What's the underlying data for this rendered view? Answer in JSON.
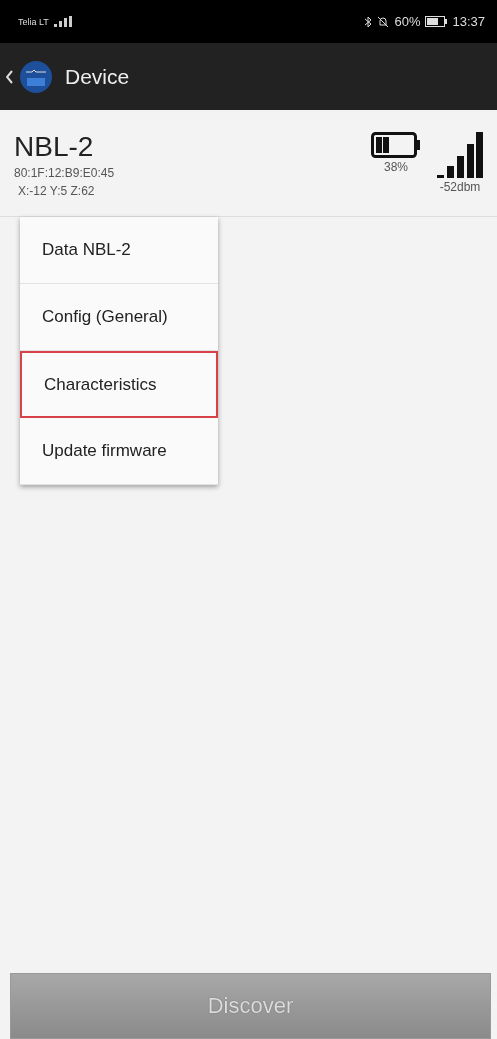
{
  "status_bar": {
    "carrier": "Telia LT",
    "battery": "60%",
    "time": "13:37"
  },
  "toolbar": {
    "title": "Device"
  },
  "device": {
    "name": "NBL-2",
    "address": "80:1F:12:B9:E0:45",
    "axes": "X:-12 Y:5 Z:62",
    "battery": "38%",
    "signal": "-52dbm"
  },
  "menu": [
    {
      "label": "Data NBL-2",
      "selected": false
    },
    {
      "label": "Config (General)",
      "selected": false
    },
    {
      "label": "Characteristics",
      "selected": true
    },
    {
      "label": "Update firmware",
      "selected": false
    }
  ],
  "discover_button": {
    "label": "Discover",
    "disabled": true
  }
}
